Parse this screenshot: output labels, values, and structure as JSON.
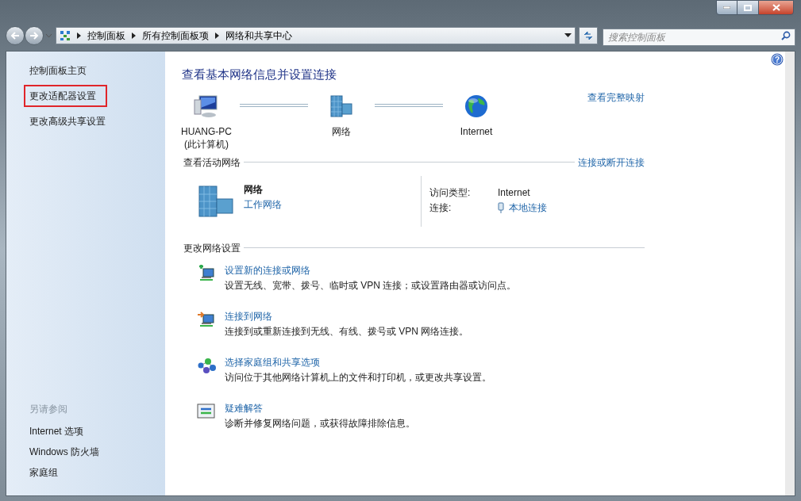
{
  "address_bar": {
    "crumbs": [
      "控制面板",
      "所有控制面板项",
      "网络和共享中心"
    ]
  },
  "search": {
    "placeholder": "搜索控制面板"
  },
  "help": {
    "glyph": "?"
  },
  "sidebar": {
    "items": [
      {
        "label": "控制面板主页",
        "highlighted": false
      },
      {
        "label": "更改适配器设置",
        "highlighted": true
      },
      {
        "label": "更改高级共享设置",
        "highlighted": false
      }
    ],
    "see_also": {
      "title": "另请参阅",
      "items": [
        "Internet 选项",
        "Windows 防火墙",
        "家庭组"
      ]
    }
  },
  "main": {
    "title": "查看基本网络信息并设置连接",
    "map": {
      "nodes": [
        {
          "kind": "computer",
          "label": "HUANG-PC",
          "sublabel": "(此计算机)"
        },
        {
          "kind": "network",
          "label": "网络"
        },
        {
          "kind": "internet",
          "label": "Internet"
        }
      ],
      "link": "查看完整映射"
    },
    "active": {
      "title": "查看活动网络",
      "link": "连接或断开连接",
      "network_name": "网络",
      "network_type": "工作网络",
      "access_label": "访问类型:",
      "access_value": "Internet",
      "conn_label": "连接:",
      "conn_value": "本地连接"
    },
    "settings": {
      "title": "更改网络设置",
      "tasks": [
        {
          "kind": "new",
          "title": "设置新的连接或网络",
          "desc": "设置无线、宽带、拨号、临时或 VPN 连接；或设置路由器或访问点。"
        },
        {
          "kind": "connect",
          "title": "连接到网络",
          "desc": "连接到或重新连接到无线、有线、拨号或 VPN 网络连接。"
        },
        {
          "kind": "homegroup",
          "title": "选择家庭组和共享选项",
          "desc": "访问位于其他网络计算机上的文件和打印机，或更改共享设置。"
        },
        {
          "kind": "troubleshoot",
          "title": "疑难解答",
          "desc": "诊断并修复网络问题，或获得故障排除信息。"
        }
      ]
    }
  }
}
